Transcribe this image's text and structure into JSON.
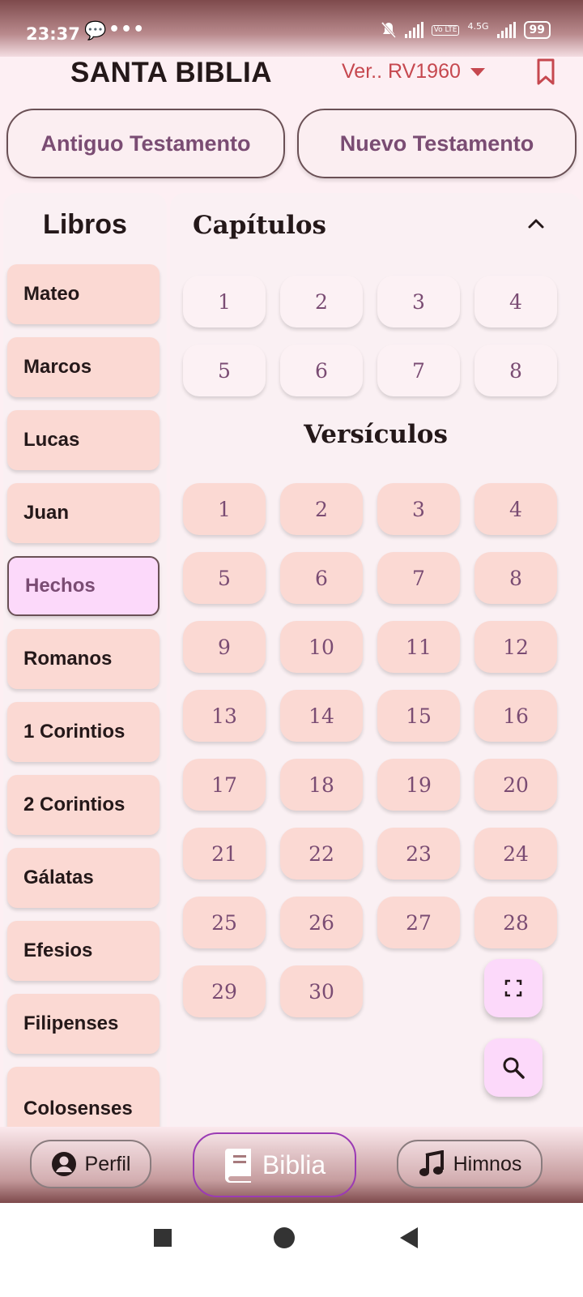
{
  "status_bar": {
    "time": "23:37",
    "notification_icon": "chat-bubble-icon",
    "more": "•••",
    "network": "4.5G",
    "lte": "Vo LTE",
    "battery": "99"
  },
  "header": {
    "title": "SANTA BIBLIA",
    "version": "Ver.. RV1960",
    "bookmark_icon": "bookmark-icon"
  },
  "testaments": {
    "old": "Antiguo Testamento",
    "new": "Nuevo Testamento"
  },
  "books": {
    "title": "Libros",
    "items": [
      "Mateo",
      "Marcos",
      "Lucas",
      "Juan",
      "Hechos",
      "Romanos",
      "1 Corintios",
      "2 Corintios",
      "Gálatas",
      "Efesios",
      "Filipenses",
      "Colosenses"
    ],
    "selected": "Hechos"
  },
  "chapters": {
    "title": "Capítulos",
    "items": [
      "1",
      "2",
      "3",
      "4",
      "5",
      "6",
      "7",
      "8"
    ]
  },
  "verses": {
    "title": "Versículos",
    "items": [
      "1",
      "2",
      "3",
      "4",
      "5",
      "6",
      "7",
      "8",
      "9",
      "10",
      "11",
      "12",
      "13",
      "14",
      "15",
      "16",
      "17",
      "18",
      "19",
      "20",
      "21",
      "22",
      "23",
      "24",
      "25",
      "26",
      "27",
      "28",
      "29",
      "30"
    ]
  },
  "bottom_nav": {
    "perfil": "Perfil",
    "biblia": "Biblia",
    "himnos": "Himnos"
  },
  "colors": {
    "accent": "#7a4c73",
    "version": "#c6484f",
    "verse_bg": "#fbd9d3",
    "selected_bg": "#fcd9fa"
  }
}
